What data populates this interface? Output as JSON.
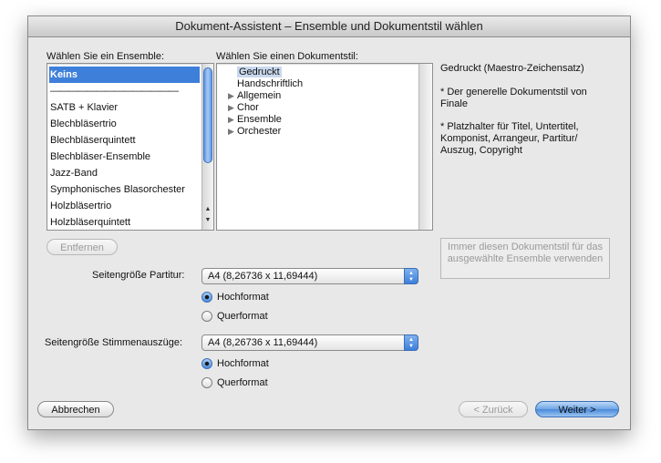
{
  "window": {
    "title": "Dokument-Assistent – Ensemble und Dokumentstil wählen"
  },
  "ensemble": {
    "label": "Wählen Sie ein Ensemble:",
    "items": [
      "Keins",
      "——————————————",
      "SATB + Klavier",
      "Blechbläsertrio",
      "Blechbläserquintett",
      "Blechbläser-Ensemble",
      "Jazz-Band",
      "Symphonisches Blasorchester",
      "Holzbläsertrio",
      "Holzbläserquintett"
    ],
    "selected": "Keins",
    "remove_button": "Entfernen"
  },
  "docstyle": {
    "label": "Wählen Sie einen Dokumentstil:",
    "items": [
      {
        "label": "Gedruckt",
        "expandable": false
      },
      {
        "label": "Handschriftlich",
        "expandable": false
      },
      {
        "label": "Allgemein",
        "expandable": true
      },
      {
        "label": "Chor",
        "expandable": true
      },
      {
        "label": "Ensemble",
        "expandable": true
      },
      {
        "label": "Orchester",
        "expandable": true
      }
    ],
    "selected": "Gedruckt"
  },
  "description": {
    "title": "Gedruckt (Maestro-Zeichensatz)",
    "line1": "* Der generelle Dokumentstil von Finale",
    "line2": "* Platzhalter für Titel, Untertitel, Komponist, Arrangeur, Partitur/ Auszug, Copyright"
  },
  "always_use_button": "Immer diesen Dokumentstil für das ausgewählte Ensemble verwenden",
  "score_page": {
    "label": "Seitengröße Partitur:",
    "value": "A4 (8,26736 x 11,69444)",
    "portrait": "Hochformat",
    "landscape": "Querformat",
    "orientation": "Hochformat"
  },
  "parts_page": {
    "label": "Seitengröße Stimmenauszüge:",
    "value": "A4 (8,26736 x 11,69444)",
    "portrait": "Hochformat",
    "landscape": "Querformat",
    "orientation": "Hochformat"
  },
  "footer": {
    "cancel": "Abbrechen",
    "back": "< Zurück",
    "next": "Weiter >"
  }
}
